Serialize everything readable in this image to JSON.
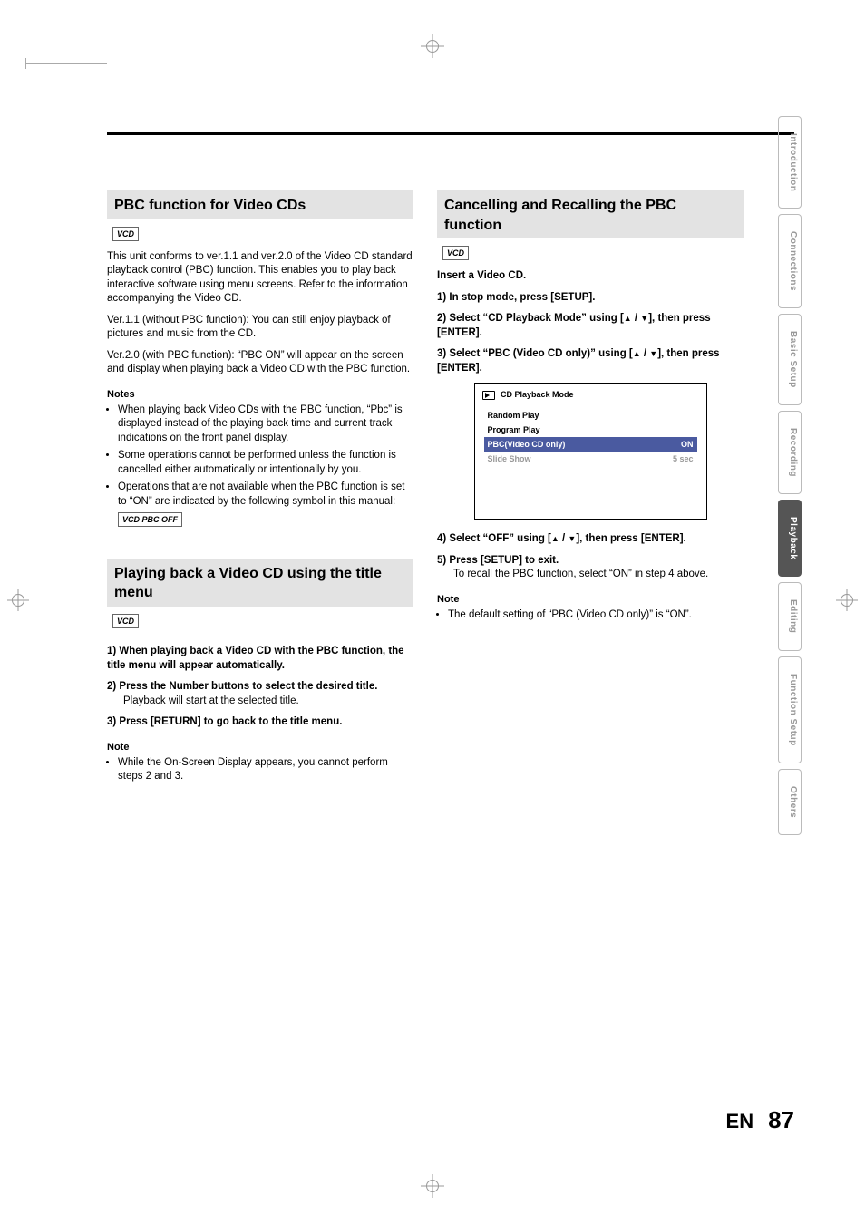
{
  "tabs": {
    "t1": "Introduction",
    "t2": "Connections",
    "t3": "Basic Setup",
    "t4": "Recording",
    "t5": "Playback",
    "t6": "Editing",
    "t7": "Function Setup",
    "t8": "Others"
  },
  "left": {
    "sec1": {
      "title": "PBC function for Video CDs",
      "badge": "VCD",
      "p1": "This unit conforms to ver.1.1 and ver.2.0 of the Video CD standard playback control (PBC) function. This enables you to play back interactive software using menu screens. Refer to the information accompanying the Video CD.",
      "p2": "Ver.1.1 (without PBC function): You can still enjoy playback of pictures and music from the CD.",
      "p3": "Ver.2.0 (with PBC function): “PBC ON” will appear on the screen and display when playing back a Video CD with the PBC function.",
      "notesTitle": "Notes",
      "n1": "When playing back Video CDs with the PBC function, “Pbc” is displayed instead of the playing back time and current track indications on the front panel display.",
      "n2": "Some operations cannot be performed unless the function is cancelled either automatically or intentionally by you.",
      "n3": "Operations that are not available when the PBC function is set to “ON” are indicated by the following symbol in this manual:",
      "pbcoff": "VCD PBC OFF"
    },
    "sec2": {
      "title": "Playing back a Video CD using the title menu",
      "badge": "VCD",
      "s1": "1) When playing back a Video CD with the PBC function, the title menu will appear automatically.",
      "s2": "2) Press the Number buttons to select the desired title.",
      "s2b": "Playback will start at the selected title.",
      "s3": "3) Press [RETURN] to go back to the title menu.",
      "noteTitle": "Note",
      "noteBody": "While the On-Screen Display appears, you cannot perform steps 2 and 3."
    }
  },
  "right": {
    "sec1": {
      "title": "Cancelling and Recalling the PBC function",
      "badge": "VCD",
      "intro": "Insert a Video CD.",
      "s1": "1) In stop mode, press [SETUP].",
      "s2a": "2) Select “CD Playback Mode” using [",
      "s2b": " / ",
      "s2c": "], then press [ENTER].",
      "s3a": "3) Select “PBC (Video CD only)” using [",
      "s3b": " / ",
      "s3c": "], then press [ENTER].",
      "menu": {
        "title": "CD Playback Mode",
        "r1": "Random Play",
        "r2": "Program Play",
        "r3L": "PBC(Video CD only)",
        "r3R": "ON",
        "r4L": "Slide Show",
        "r4R": "5 sec"
      },
      "s4a": "4) Select “OFF” using [",
      "s4b": " / ",
      "s4c": "], then press [ENTER].",
      "s5": "5) Press [SETUP] to exit.",
      "s5b": "To recall the PBC function, select “ON” in step 4 above.",
      "noteTitle": "Note",
      "noteBody": "The default setting of “PBC (Video CD only)” is “ON”."
    }
  },
  "footer": {
    "lang": "EN",
    "page": "87"
  }
}
